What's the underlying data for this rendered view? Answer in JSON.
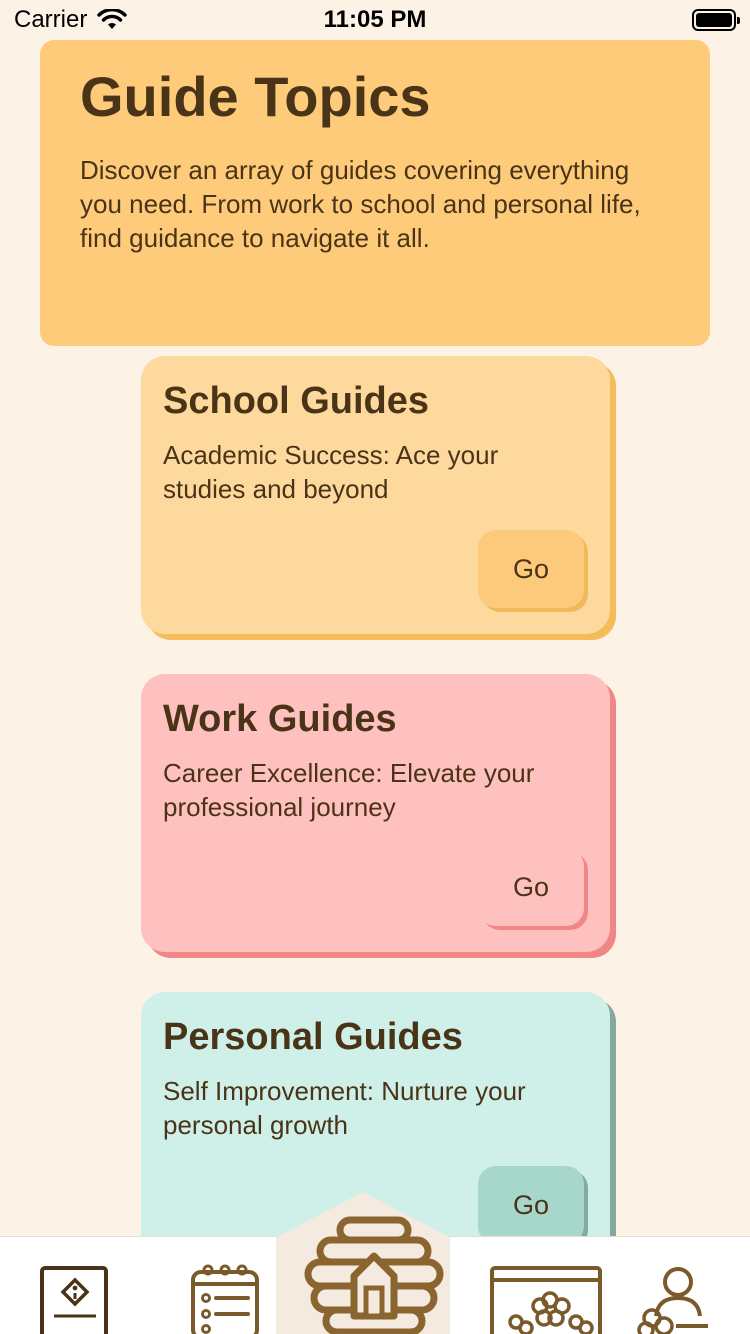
{
  "status_bar": {
    "carrier": "Carrier",
    "time": "11:05 PM"
  },
  "header": {
    "title": "Guide Topics",
    "description": "Discover an array of guides covering everything you need. From work to school and personal life, find guidance to navigate it all."
  },
  "guides": [
    {
      "title": "School Guides",
      "description": "Academic Success: Ace your studies and beyond",
      "button_label": "Go",
      "color": "#fed99e"
    },
    {
      "title": "Work Guides",
      "description": "Career Excellence: Elevate your professional journey",
      "button_label": "Go",
      "color": "#ffc1c0"
    },
    {
      "title": "Personal Guides",
      "description": "Self Improvement: Nurture your personal growth",
      "button_label": "Go",
      "color": "#cff0e9"
    }
  ],
  "tab_bar": {
    "items": [
      {
        "icon": "info-book-icon"
      },
      {
        "icon": "checklist-notepad-icon"
      },
      {
        "icon": "beehive-home-icon",
        "selected": true
      },
      {
        "icon": "flower-calendar-icon"
      },
      {
        "icon": "meditation-person-icon"
      }
    ],
    "icon_color": "#7a5a2a",
    "accent_color": "#f4eadf"
  }
}
